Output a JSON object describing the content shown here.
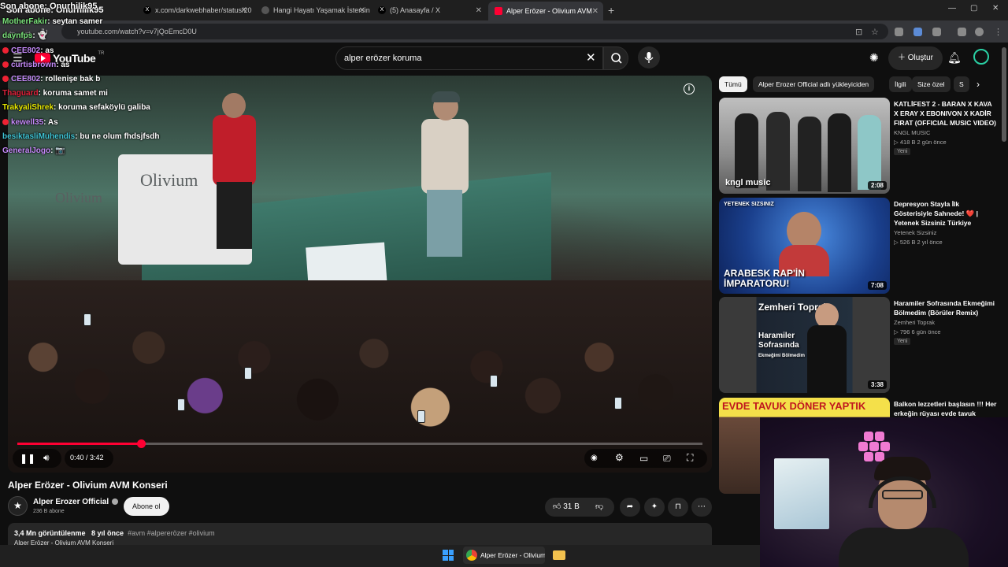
{
  "browser": {
    "tabs": [
      {
        "label": "Son abone: Onurhilik95"
      },
      {
        "label": "x.com/darkwebhaber/status/20"
      },
      {
        "label": "Hangi Hayatı Yaşamak İstersin?"
      },
      {
        "label": "(5) Anasayfa / X"
      },
      {
        "label": "Alper Erözer - Olivium AVM"
      }
    ],
    "new_tab": "+",
    "url": "youtube.com/watch?v=v7jQoEmcD0U"
  },
  "youtube": {
    "logo_text": "YouTube",
    "logo_region": "TR",
    "search_value": "alper erözer koruma",
    "create_label": "Oluştur"
  },
  "chat": {
    "title": "Son abone: Onurhilik95",
    "lines": [
      {
        "user": "MotherFakir",
        "msg": ": seytan samer",
        "color": "#7be37b"
      },
      {
        "user": "daynfps",
        "msg": ": 👻",
        "color": "#7be37b"
      },
      {
        "user": "CEE802",
        "msg": ": as",
        "color": "#c58af9"
      },
      {
        "user": "curtisbrown",
        "msg": ": as",
        "color": "#c58af9"
      },
      {
        "user": "CEE802",
        "msg": ": rollenişe bak b",
        "color": "#c58af9"
      },
      {
        "user": "Thaguard",
        "msg": ": koruma samet mi",
        "color": "#e0213a"
      },
      {
        "user": "TrakyaliShrek",
        "msg": ": koruma sefaköylü galiba",
        "color": "#e6e600"
      },
      {
        "user": "kewell35",
        "msg": ": As",
        "color": "#c58af9"
      },
      {
        "user": "besiktasliMuhendis",
        "msg": ": bu ne olum fhdsjfsdh",
        "color": "#3fc4d4"
      },
      {
        "user": "GeneralJogo",
        "msg": ": 📷",
        "color": "#c58af9"
      }
    ]
  },
  "player": {
    "current_time": "0:40",
    "duration": "3:42",
    "time_display": "0:40 / 3:42",
    "progress_fraction": 0.18,
    "brand_left": "Olivium",
    "brand_table": "Olivium"
  },
  "video": {
    "title": "Alper Erözer - Olivium AVM Konseri",
    "channel": "Alper Erozer Official",
    "subscribers": "236 B abone",
    "subscribe_label": "Abone ol",
    "likes": "31 B",
    "views": "3,4 Mn görüntülenme",
    "age": "8 yıl önce",
    "tags": "#avm #alpererözer #olivium",
    "desc_line": "Alper Erözer - Olivium AVM Konseri"
  },
  "chips": [
    {
      "label": "Tümü",
      "active": true
    },
    {
      "label": "Alper Erozer Official adlı yükleyiciden",
      "active": false
    },
    {
      "label": "İlgili",
      "active": false
    },
    {
      "label": "Size özel",
      "active": false
    },
    {
      "label": "S",
      "active": false
    }
  ],
  "recommendations": [
    {
      "title": "KATLİFEST 2 - BARAN X KAVA X ERAY X EBONIVON X KADİR FIRAT (OFFICIAL MUSIC VIDEO)",
      "channel": "KNGL MUSIC",
      "meta": "▷ 418 B  2 gün önce",
      "badge": "Yeni",
      "duration": "2:08",
      "thumb_text": "kngl music"
    },
    {
      "title": "Depresyon Stayla İlk Gösterisiyle Sahnede! ❤️ | Yetenek Sizsiniz Türkiye",
      "channel": "Yetenek Sizsiniz",
      "meta": "▷ 526 B  2 yıl önce",
      "badge": "",
      "duration": "7:08",
      "thumb_text": "ARABESK RAP'İN İMPARATORU!",
      "thumb_logo": "YETENEK SIZSINIZ"
    },
    {
      "title": "Haramiler Sofrasında Ekmeğimi Bölmedim (Börüler Remix)",
      "channel": "Zemheri Toprak",
      "meta": "▷ 796  6 gün önce",
      "badge": "Yeni",
      "duration": "3:38",
      "thumb_title": "Zemheri Toprak",
      "thumb_text": "Haramiler Sofrasında",
      "thumb_sub": "Ekmeğimi Bölmedim"
    },
    {
      "title": "Balkon lezzetleri başlasın !!! Her erkeğin rüyası evde tavuk",
      "thumb_text": "EVDE TAVUK DÖNER YAPTIK"
    }
  ],
  "taskbar": {
    "chrome_label": "Alper Erözer - Olivium A"
  }
}
